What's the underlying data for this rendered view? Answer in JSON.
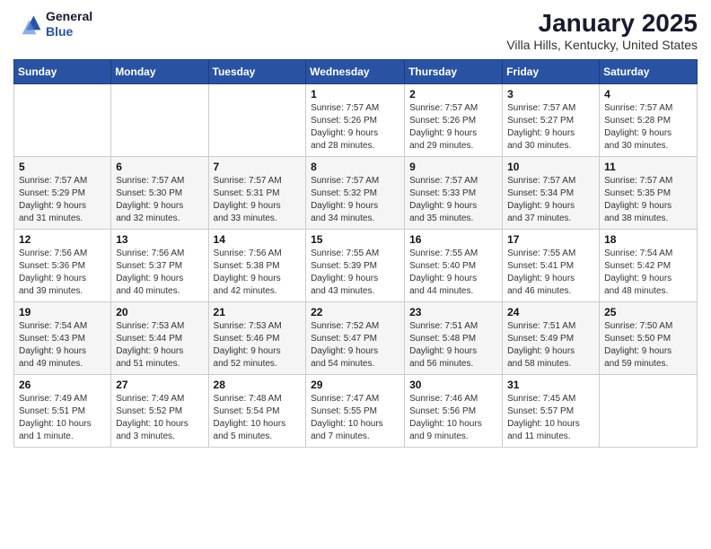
{
  "header": {
    "logo_line1": "General",
    "logo_line2": "Blue",
    "month": "January 2025",
    "location": "Villa Hills, Kentucky, United States"
  },
  "weekdays": [
    "Sunday",
    "Monday",
    "Tuesday",
    "Wednesday",
    "Thursday",
    "Friday",
    "Saturday"
  ],
  "weeks": [
    [
      {
        "day": "",
        "detail": ""
      },
      {
        "day": "",
        "detail": ""
      },
      {
        "day": "",
        "detail": ""
      },
      {
        "day": "1",
        "detail": "Sunrise: 7:57 AM\nSunset: 5:26 PM\nDaylight: 9 hours\nand 28 minutes."
      },
      {
        "day": "2",
        "detail": "Sunrise: 7:57 AM\nSunset: 5:26 PM\nDaylight: 9 hours\nand 29 minutes."
      },
      {
        "day": "3",
        "detail": "Sunrise: 7:57 AM\nSunset: 5:27 PM\nDaylight: 9 hours\nand 30 minutes."
      },
      {
        "day": "4",
        "detail": "Sunrise: 7:57 AM\nSunset: 5:28 PM\nDaylight: 9 hours\nand 30 minutes."
      }
    ],
    [
      {
        "day": "5",
        "detail": "Sunrise: 7:57 AM\nSunset: 5:29 PM\nDaylight: 9 hours\nand 31 minutes."
      },
      {
        "day": "6",
        "detail": "Sunrise: 7:57 AM\nSunset: 5:30 PM\nDaylight: 9 hours\nand 32 minutes."
      },
      {
        "day": "7",
        "detail": "Sunrise: 7:57 AM\nSunset: 5:31 PM\nDaylight: 9 hours\nand 33 minutes."
      },
      {
        "day": "8",
        "detail": "Sunrise: 7:57 AM\nSunset: 5:32 PM\nDaylight: 9 hours\nand 34 minutes."
      },
      {
        "day": "9",
        "detail": "Sunrise: 7:57 AM\nSunset: 5:33 PM\nDaylight: 9 hours\nand 35 minutes."
      },
      {
        "day": "10",
        "detail": "Sunrise: 7:57 AM\nSunset: 5:34 PM\nDaylight: 9 hours\nand 37 minutes."
      },
      {
        "day": "11",
        "detail": "Sunrise: 7:57 AM\nSunset: 5:35 PM\nDaylight: 9 hours\nand 38 minutes."
      }
    ],
    [
      {
        "day": "12",
        "detail": "Sunrise: 7:56 AM\nSunset: 5:36 PM\nDaylight: 9 hours\nand 39 minutes."
      },
      {
        "day": "13",
        "detail": "Sunrise: 7:56 AM\nSunset: 5:37 PM\nDaylight: 9 hours\nand 40 minutes."
      },
      {
        "day": "14",
        "detail": "Sunrise: 7:56 AM\nSunset: 5:38 PM\nDaylight: 9 hours\nand 42 minutes."
      },
      {
        "day": "15",
        "detail": "Sunrise: 7:55 AM\nSunset: 5:39 PM\nDaylight: 9 hours\nand 43 minutes."
      },
      {
        "day": "16",
        "detail": "Sunrise: 7:55 AM\nSunset: 5:40 PM\nDaylight: 9 hours\nand 44 minutes."
      },
      {
        "day": "17",
        "detail": "Sunrise: 7:55 AM\nSunset: 5:41 PM\nDaylight: 9 hours\nand 46 minutes."
      },
      {
        "day": "18",
        "detail": "Sunrise: 7:54 AM\nSunset: 5:42 PM\nDaylight: 9 hours\nand 48 minutes."
      }
    ],
    [
      {
        "day": "19",
        "detail": "Sunrise: 7:54 AM\nSunset: 5:43 PM\nDaylight: 9 hours\nand 49 minutes."
      },
      {
        "day": "20",
        "detail": "Sunrise: 7:53 AM\nSunset: 5:44 PM\nDaylight: 9 hours\nand 51 minutes."
      },
      {
        "day": "21",
        "detail": "Sunrise: 7:53 AM\nSunset: 5:46 PM\nDaylight: 9 hours\nand 52 minutes."
      },
      {
        "day": "22",
        "detail": "Sunrise: 7:52 AM\nSunset: 5:47 PM\nDaylight: 9 hours\nand 54 minutes."
      },
      {
        "day": "23",
        "detail": "Sunrise: 7:51 AM\nSunset: 5:48 PM\nDaylight: 9 hours\nand 56 minutes."
      },
      {
        "day": "24",
        "detail": "Sunrise: 7:51 AM\nSunset: 5:49 PM\nDaylight: 9 hours\nand 58 minutes."
      },
      {
        "day": "25",
        "detail": "Sunrise: 7:50 AM\nSunset: 5:50 PM\nDaylight: 9 hours\nand 59 minutes."
      }
    ],
    [
      {
        "day": "26",
        "detail": "Sunrise: 7:49 AM\nSunset: 5:51 PM\nDaylight: 10 hours\nand 1 minute."
      },
      {
        "day": "27",
        "detail": "Sunrise: 7:49 AM\nSunset: 5:52 PM\nDaylight: 10 hours\nand 3 minutes."
      },
      {
        "day": "28",
        "detail": "Sunrise: 7:48 AM\nSunset: 5:54 PM\nDaylight: 10 hours\nand 5 minutes."
      },
      {
        "day": "29",
        "detail": "Sunrise: 7:47 AM\nSunset: 5:55 PM\nDaylight: 10 hours\nand 7 minutes."
      },
      {
        "day": "30",
        "detail": "Sunrise: 7:46 AM\nSunset: 5:56 PM\nDaylight: 10 hours\nand 9 minutes."
      },
      {
        "day": "31",
        "detail": "Sunrise: 7:45 AM\nSunset: 5:57 PM\nDaylight: 10 hours\nand 11 minutes."
      },
      {
        "day": "",
        "detail": ""
      }
    ]
  ]
}
